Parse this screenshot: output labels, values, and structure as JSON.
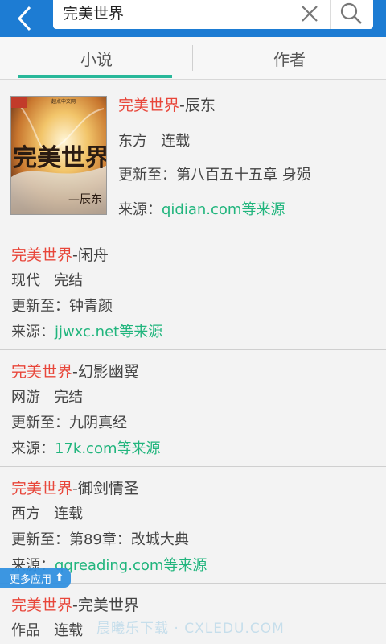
{
  "search": {
    "query": "完美世界"
  },
  "tabs": [
    {
      "label": "小说",
      "active": true
    },
    {
      "label": "作者",
      "active": false
    }
  ],
  "colors": {
    "topbar": "#1d7cd3",
    "accent_tab": "#29b89a",
    "title_highlight": "#e8463a",
    "source_link": "#21b57d"
  },
  "results": [
    {
      "title": "完美世界",
      "author": "辰东",
      "genre": "东方",
      "status": "连载",
      "update_label": "更新至：",
      "update": "第八百五十五章 身殒",
      "source_label": "来源：",
      "source": "qidian.com等来源",
      "has_cover": true,
      "cover_text": "完美世界",
      "cover_author": "—辰东"
    },
    {
      "title": "完美世界",
      "author": "闲舟",
      "genre": "现代",
      "status": "完结",
      "update_label": "更新至：",
      "update": "钟青颜",
      "source_label": "来源：",
      "source": "jjwxc.net等来源"
    },
    {
      "title": "完美世界",
      "author": "幻影幽翼",
      "genre": "网游",
      "status": "完结",
      "update_label": "更新至：",
      "update": "九阴真经",
      "source_label": "来源：",
      "source": "17k.com等来源"
    },
    {
      "title": "完美世界",
      "author": "御剑情圣",
      "genre": "西方",
      "status": "连载",
      "update_label": "更新至：",
      "update": "第89章：改城大典",
      "source_label": "来源：",
      "source": "qqreading.com等来源"
    },
    {
      "title": "完美世界",
      "author": "完美世界",
      "genre": "作品",
      "status": "连载"
    }
  ],
  "overlay": {
    "more_apps": "更多应用",
    "watermark": "晨曦乐下载 · CXLEDU.COM"
  }
}
